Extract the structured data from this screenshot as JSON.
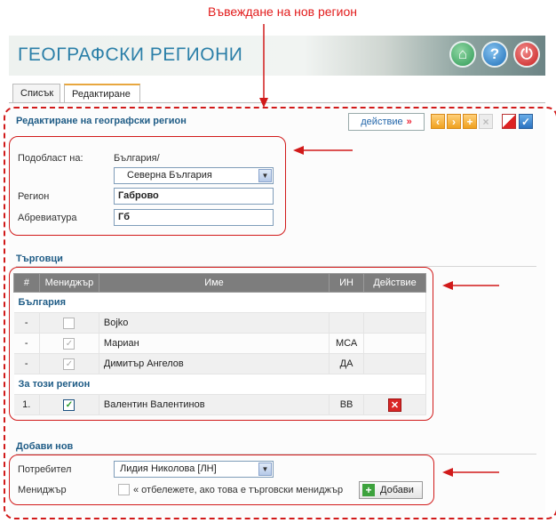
{
  "annotation": {
    "title": "Въвеждане на нов регион"
  },
  "header": {
    "title": "ГЕОГРАФСКИ РЕГИОНИ",
    "home_icon": "home-icon",
    "help_label": "?",
    "power_icon": "power-icon"
  },
  "tabs": [
    {
      "label": "Списък"
    },
    {
      "label": "Редактиране"
    }
  ],
  "edit_section": {
    "title": "Редактиране на географски регион",
    "action_label": "действие",
    "action_arrow": "»",
    "parent_label": "Подобласт на:",
    "parent_value": "България/",
    "parent_select": "Северна България",
    "region_label": "Регион",
    "region_value": "Габрово",
    "abbr_label": "Абревиатура",
    "abbr_value": "Гб"
  },
  "traders": {
    "title": "Търговци",
    "columns": [
      "#",
      "Мениджър",
      "Име",
      "ИН",
      "Действие"
    ],
    "group1": "България",
    "rows1": [
      {
        "num": "-",
        "manager": false,
        "name": "Bojko",
        "in": ""
      },
      {
        "num": "-",
        "manager": true,
        "name": "Мариан",
        "in": "МСА"
      },
      {
        "num": "-",
        "manager": true,
        "name": "Димитър Ангелов",
        "in": "ДА"
      }
    ],
    "group2": "За този регион",
    "rows2": [
      {
        "num": "1.",
        "manager": true,
        "name": "Валентин Валентинов",
        "in": "ВВ"
      }
    ]
  },
  "add_new": {
    "title": "Добави нов",
    "user_label": "Потребител",
    "user_value": "Лидия Николова [ЛН]",
    "manager_label": "Мениджър",
    "manager_hint": "« отбележете, ако това е търговски мениджър",
    "add_label": "Добави"
  },
  "colors": {
    "accent": "#1f5c86",
    "annotation": "#d11a1a"
  }
}
